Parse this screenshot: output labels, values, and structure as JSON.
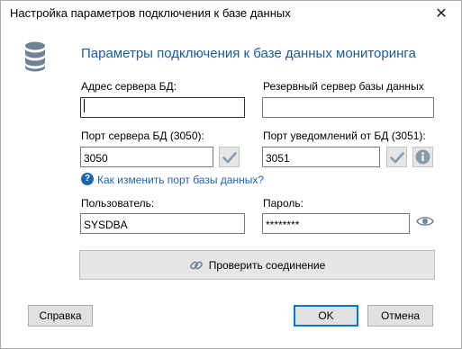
{
  "window": {
    "title": "Настройка параметров подключения к базе данных",
    "close_glyph": "✕"
  },
  "header": {
    "icon": "database-icon",
    "text": "Параметры подключения к базе данных мониторинга"
  },
  "fields": {
    "server_address": {
      "label": "Адрес сервера БД:",
      "value": ""
    },
    "backup_server": {
      "label": "Резервный сервер базы данных",
      "value": ""
    },
    "server_port": {
      "label": "Порт сервера БД (3050):",
      "value": "3050"
    },
    "notify_port": {
      "label": "Порт уведомлений от БД (3051):",
      "value": "3051"
    },
    "user": {
      "label": "Пользователь:",
      "value": "SYSDBA"
    },
    "password": {
      "label": "Пароль:",
      "value": "********"
    }
  },
  "link": {
    "text": "Как изменить порт базы данных?",
    "icon": "help-icon"
  },
  "buttons": {
    "test_connection": "Проверить соединение",
    "help": "Справка",
    "ok": "OK",
    "cancel": "Отмена"
  },
  "colors": {
    "accent": "#1a5a9e",
    "link": "#1c64b4",
    "button_bg": "#e1e1e1",
    "icon_gray": "#8a9aa8",
    "default_border": "#0078d7"
  }
}
